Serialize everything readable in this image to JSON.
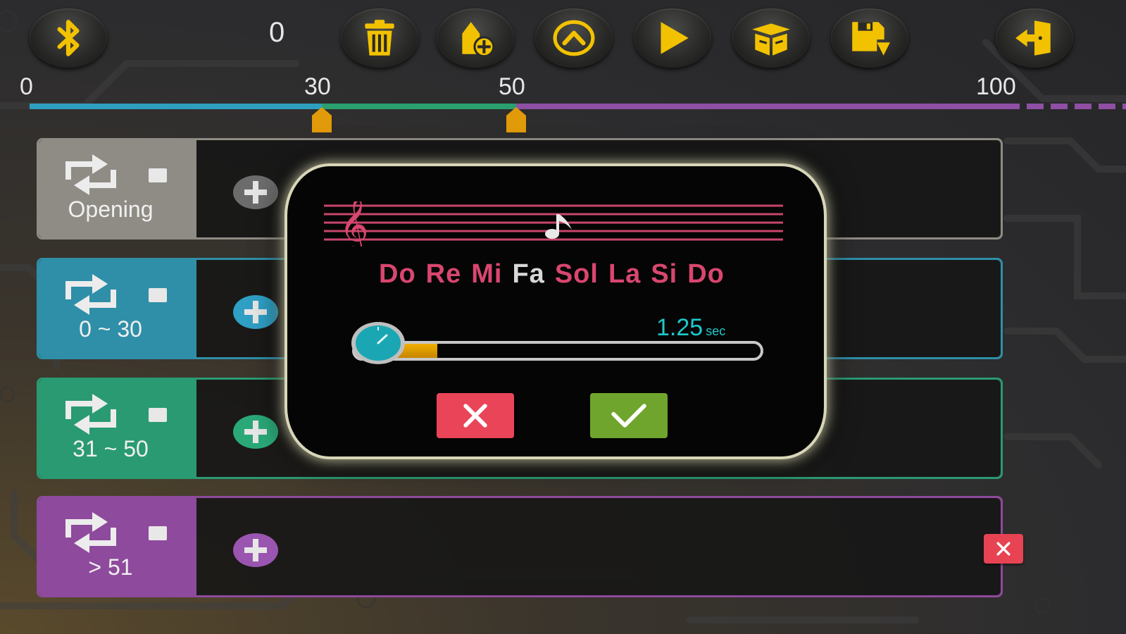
{
  "colors": {
    "accent_yellow": "#f2c200",
    "opening": "#8f8c85",
    "range_0_30": "#2f8fa8",
    "range_31_50": "#2a9a72",
    "range_51_plus": "#8e4a9c",
    "note_pink": "#d9466f",
    "duration_cyan": "#1fc9cc"
  },
  "toolbar": {
    "counter": "0",
    "buttons": [
      {
        "name": "bluetooth-button",
        "icon": "bluetooth-icon"
      },
      {
        "name": "delete-button",
        "icon": "trash-icon"
      },
      {
        "name": "add-block-button",
        "icon": "add-tag-icon"
      },
      {
        "name": "up-button",
        "icon": "chevron-up-icon"
      },
      {
        "name": "play-button",
        "icon": "play-icon"
      },
      {
        "name": "open-box-button",
        "icon": "box-icon"
      },
      {
        "name": "save-button",
        "icon": "save-icon"
      },
      {
        "name": "exit-button",
        "icon": "exit-icon"
      }
    ]
  },
  "timeline": {
    "ticks": [
      "0",
      "30",
      "50",
      "100"
    ],
    "markers": [
      30,
      50
    ]
  },
  "rows": [
    {
      "label": "Opening",
      "color": "#8f8c85"
    },
    {
      "label": "0 ~ 30",
      "color": "#2f8fa8"
    },
    {
      "label": "31 ~ 50",
      "color": "#2a9a72"
    },
    {
      "label": "> 51",
      "color": "#8e4a9c"
    }
  ],
  "dialog": {
    "notes": [
      "Do",
      "Re",
      "Mi",
      "Fa",
      "Sol",
      "La",
      "Si",
      "Do"
    ],
    "selected_note_index": 3,
    "duration_value": "1.25",
    "duration_unit": "sec",
    "slider_fraction": 0.2
  }
}
